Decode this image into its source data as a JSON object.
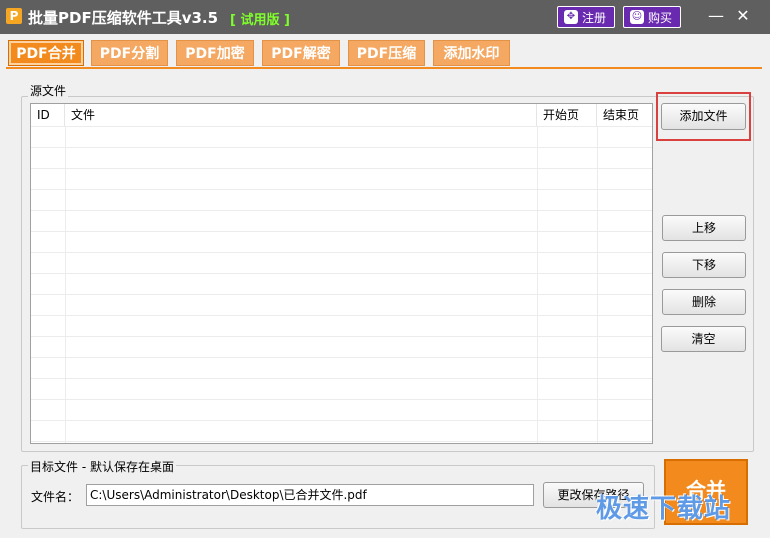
{
  "window": {
    "title": "批量PDF压缩软件工具v3.5",
    "trial_badge": "[ 试用版 ]",
    "logo_letter": "P",
    "register_label": "注册",
    "buy_label": "购买",
    "minimize_glyph": "—",
    "close_glyph": "✕"
  },
  "tabs": [
    {
      "label": "PDF合并",
      "active": true
    },
    {
      "label": "PDF分割",
      "active": false
    },
    {
      "label": "PDF加密",
      "active": false
    },
    {
      "label": "PDF解密",
      "active": false
    },
    {
      "label": "PDF压缩",
      "active": false
    },
    {
      "label": "添加水印",
      "active": false
    }
  ],
  "source": {
    "group_label": "源文件",
    "columns": [
      "ID",
      "文件",
      "开始页",
      "结束页"
    ],
    "rows": []
  },
  "actions": {
    "add_file": "添加文件",
    "move_up": "上移",
    "move_down": "下移",
    "delete": "删除",
    "clear": "清空"
  },
  "target": {
    "group_label": "目标文件 - 默认保存在桌面",
    "filename_label": "文件名：",
    "path_value": "C:\\Users\\Administrator\\Desktop\\已合并文件.pdf",
    "change_path": "更改保存路径"
  },
  "merge_label": "合并",
  "watermark": "极速下载站",
  "colors": {
    "titlebar": "#5f5f5f",
    "accent_orange": "#f28a1d",
    "tab_orange": "#f4a862",
    "purple": "#6a2ab0",
    "trial_green": "#7fff2a",
    "highlight_red": "#d9413f"
  }
}
